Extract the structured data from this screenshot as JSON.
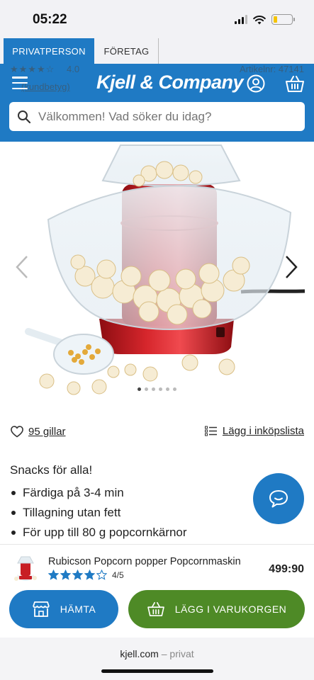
{
  "status_bar": {
    "time": "05:22",
    "battery_level": 0.2,
    "battery_color": "#f5c400"
  },
  "tabs": [
    {
      "label": "PRIVATPERSON",
      "active": true
    },
    {
      "label": "FÖRETAG",
      "active": false
    }
  ],
  "header": {
    "brand": "Kjell & Company",
    "brand_color": "#1f7ac4",
    "ghost_rating": "4.0",
    "ghost_article": "Artikelnr: 47141",
    "ghost_review": "(kundbetyg)"
  },
  "search": {
    "placeholder": "Välkommen! Vad söker du idag?"
  },
  "carousel": {
    "total": 6,
    "current": 1
  },
  "social": {
    "likes": "95 gillar",
    "shopping_list": "Lägg i inköpslista"
  },
  "description": {
    "title": "Snacks för alla!",
    "bullets": [
      "Färdiga på 3-4 min",
      "Tillagning utan fett",
      "För upp till 80 g popcornkärnor"
    ]
  },
  "product": {
    "name": "Rubicson Popcorn popper Popcornmaskin",
    "rating": 4,
    "rating_max": 5,
    "rating_text": "4/5",
    "price": "499:90"
  },
  "buttons": {
    "fetch": "HÄMTA",
    "add_to_cart": "LÄGG I VARUKORGEN",
    "fetch_color": "#1f7ac4",
    "cart_color": "#4e8a26"
  },
  "footer": {
    "domain": "kjell.com",
    "separator": "–",
    "mode": "privat"
  }
}
